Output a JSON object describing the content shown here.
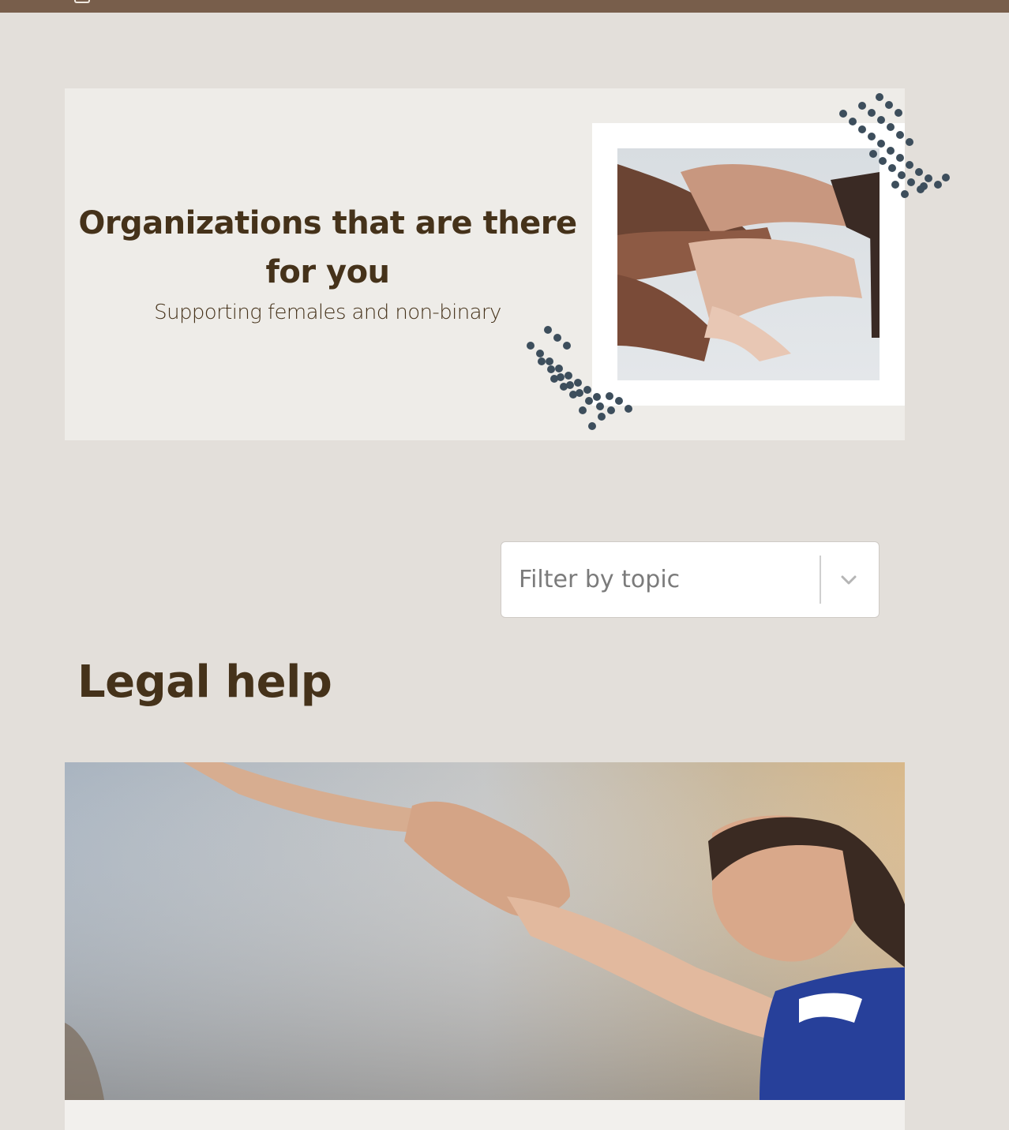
{
  "hero": {
    "title": "Organizations that are there for you",
    "subtitle": "Supporting females and non-binary",
    "image": "hands-holding-photo"
  },
  "filter": {
    "placeholder": "Filter by topic",
    "icon": "chevron-down-icon"
  },
  "section": {
    "title": "Legal help",
    "image": "helping-hand-photo"
  },
  "colors": {
    "topbar": "#785e4b",
    "background": "#e3dfda",
    "hero_bg": "#eeece8",
    "text": "#45321a",
    "dots": "#3d4e5c"
  }
}
